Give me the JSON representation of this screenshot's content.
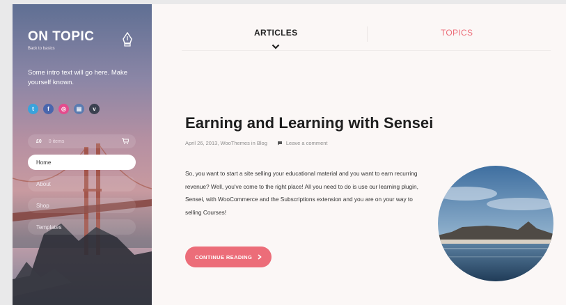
{
  "sidebar": {
    "site_title": "ON TOPIC",
    "site_subtitle": "Back to basics",
    "intro": "Some intro text will go here. Make yourself known.",
    "social": [
      {
        "icon": "twitter-icon",
        "glyph": "t",
        "color": "#3aa3dc"
      },
      {
        "icon": "facebook-icon",
        "glyph": "f",
        "color": "#4a66ad"
      },
      {
        "icon": "dribbble-icon",
        "glyph": "◎",
        "color": "#e44c8d"
      },
      {
        "icon": "linkedin-icon",
        "glyph": "▤",
        "color": "#5a7bb0"
      },
      {
        "icon": "vimeo-icon",
        "glyph": "v",
        "color": "#3b4150"
      }
    ],
    "cart": {
      "amount": "£0",
      "items": "0 items"
    },
    "nav": [
      {
        "label": "Home",
        "active": true
      },
      {
        "label": "About",
        "active": false
      },
      {
        "label": "Shop",
        "active": false
      },
      {
        "label": "Templates",
        "active": false
      }
    ]
  },
  "tabs": {
    "articles": "ARTICLES",
    "topics": "TOPICS"
  },
  "post": {
    "title": "Earning and Learning with Sensei",
    "date": "April 26, 2013,",
    "author_cat": "WooThemes in Blog",
    "comment": "Leave a comment",
    "excerpt": "So, you want to start a site selling your educational material and you want to earn recurring revenue? Well, you've come to the right place! All you need to do is use our learning plugin, Sensei, with WooCommerce and the Subscriptions extension and you are on your way to selling Courses!",
    "cta": "CONTINUE READING"
  },
  "colors": {
    "accent": "#ec6d79"
  }
}
